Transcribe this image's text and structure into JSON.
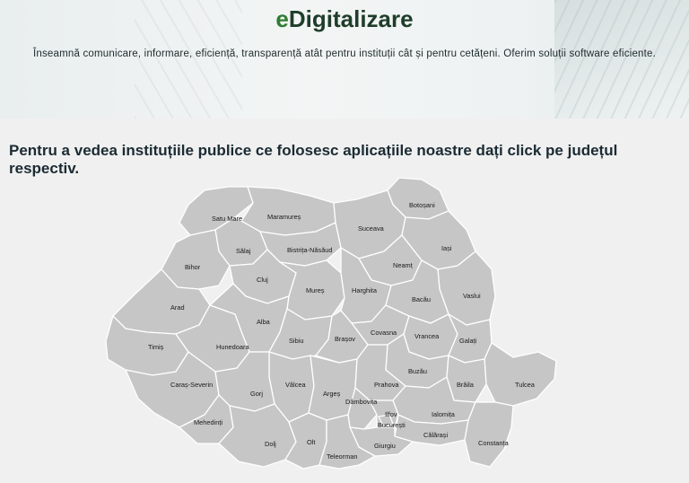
{
  "header": {
    "brand_prefix": "e",
    "brand_rest": "Digitalizare",
    "tagline": "Înseamnă comunicare, informare, eficiență, transparență atât pentru instituții cât și pentru cetățeni. Oferim soluții software eficiente."
  },
  "main": {
    "headline": "Pentru a vedea instituțiile publice ce folosesc aplicațiile noastre dați click pe județul respectiv."
  },
  "map": {
    "fill_color": "#c6c6c6",
    "counties": [
      "Satu Mare",
      "Maramureș",
      "Botoșani",
      "Suceava",
      "Iași",
      "Sălaj",
      "Bistrița-Năsăud",
      "Bihor",
      "Neamț",
      "Cluj",
      "Vaslui",
      "Mureș",
      "Harghita",
      "Bacău",
      "Arad",
      "Alba",
      "Covasna",
      "Vrancea",
      "Galați",
      "Timiș",
      "Sibiu",
      "Brașov",
      "Hunedoara",
      "Buzău",
      "Tulcea",
      "Caraș-Severin",
      "Vâlcea",
      "Argeș",
      "Prahova",
      "Brăila",
      "Gorj",
      "Dâmbovița",
      "Ialomița",
      "Ilfov",
      "Mehedinți",
      "București",
      "Călărași",
      "Dolj",
      "Olt",
      "Constanța",
      "Giurgiu",
      "Teleorman"
    ]
  }
}
